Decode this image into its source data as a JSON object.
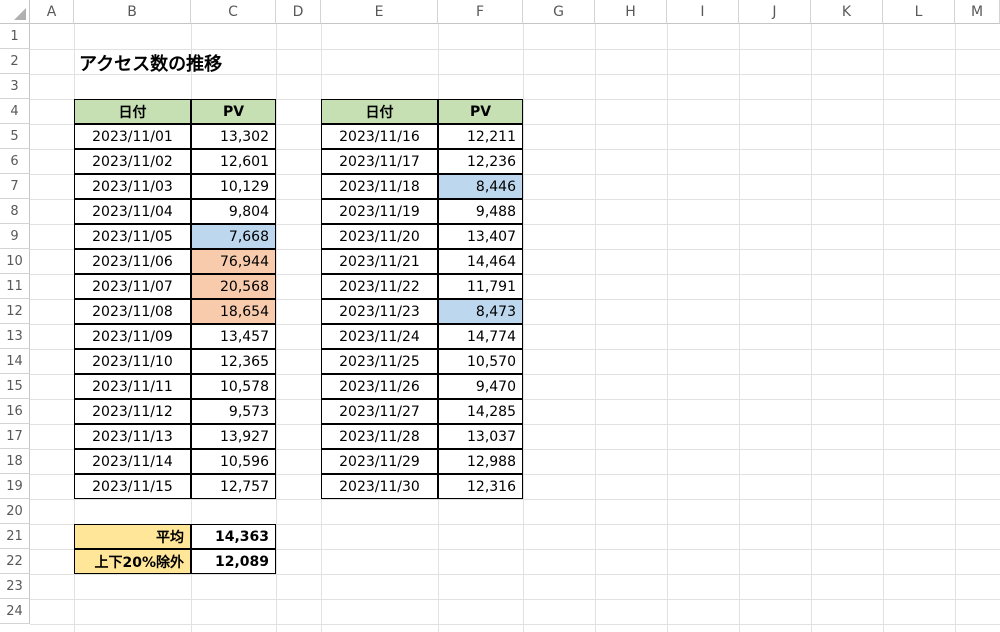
{
  "sheet": {
    "columns": [
      "A",
      "B",
      "C",
      "D",
      "E",
      "F",
      "G",
      "H",
      "I",
      "J",
      "K",
      "L",
      "M"
    ],
    "rows": [
      "1",
      "2",
      "3",
      "4",
      "5",
      "6",
      "7",
      "8",
      "9",
      "10",
      "11",
      "12",
      "13",
      "14",
      "15",
      "16",
      "17",
      "18",
      "19",
      "20",
      "21",
      "22",
      "23",
      "24"
    ],
    "title": "アクセス数の推移",
    "table1": {
      "header_date": "日付",
      "header_pv": "PV",
      "rows": [
        {
          "date": "2023/11/01",
          "pv": "13,302",
          "hl": ""
        },
        {
          "date": "2023/11/02",
          "pv": "12,601",
          "hl": ""
        },
        {
          "date": "2023/11/03",
          "pv": "10,129",
          "hl": ""
        },
        {
          "date": "2023/11/04",
          "pv": "9,804",
          "hl": ""
        },
        {
          "date": "2023/11/05",
          "pv": "7,668",
          "hl": "blue"
        },
        {
          "date": "2023/11/06",
          "pv": "76,944",
          "hl": "orange"
        },
        {
          "date": "2023/11/07",
          "pv": "20,568",
          "hl": "orange"
        },
        {
          "date": "2023/11/08",
          "pv": "18,654",
          "hl": "orange"
        },
        {
          "date": "2023/11/09",
          "pv": "13,457",
          "hl": ""
        },
        {
          "date": "2023/11/10",
          "pv": "12,365",
          "hl": ""
        },
        {
          "date": "2023/11/11",
          "pv": "10,578",
          "hl": ""
        },
        {
          "date": "2023/11/12",
          "pv": "9,573",
          "hl": ""
        },
        {
          "date": "2023/11/13",
          "pv": "13,927",
          "hl": ""
        },
        {
          "date": "2023/11/14",
          "pv": "10,596",
          "hl": ""
        },
        {
          "date": "2023/11/15",
          "pv": "12,757",
          "hl": ""
        }
      ]
    },
    "table2": {
      "header_date": "日付",
      "header_pv": "PV",
      "rows": [
        {
          "date": "2023/11/16",
          "pv": "12,211",
          "hl": ""
        },
        {
          "date": "2023/11/17",
          "pv": "12,236",
          "hl": ""
        },
        {
          "date": "2023/11/18",
          "pv": "8,446",
          "hl": "blue"
        },
        {
          "date": "2023/11/19",
          "pv": "9,488",
          "hl": ""
        },
        {
          "date": "2023/11/20",
          "pv": "13,407",
          "hl": ""
        },
        {
          "date": "2023/11/21",
          "pv": "14,464",
          "hl": ""
        },
        {
          "date": "2023/11/22",
          "pv": "11,791",
          "hl": ""
        },
        {
          "date": "2023/11/23",
          "pv": "8,473",
          "hl": "blue"
        },
        {
          "date": "2023/11/24",
          "pv": "14,774",
          "hl": ""
        },
        {
          "date": "2023/11/25",
          "pv": "10,570",
          "hl": ""
        },
        {
          "date": "2023/11/26",
          "pv": "9,470",
          "hl": ""
        },
        {
          "date": "2023/11/27",
          "pv": "14,285",
          "hl": ""
        },
        {
          "date": "2023/11/28",
          "pv": "13,037",
          "hl": ""
        },
        {
          "date": "2023/11/29",
          "pv": "12,988",
          "hl": ""
        },
        {
          "date": "2023/11/30",
          "pv": "12,316",
          "hl": ""
        }
      ]
    },
    "summary": {
      "average_label": "平均",
      "average_value": "14,363",
      "trimmed_label": "上下20%除外",
      "trimmed_value": "12,089"
    },
    "colors": {
      "header_green": "#c6e0b4",
      "highlight_blue": "#bdd7ee",
      "highlight_orange": "#f8cbad",
      "summary_yellow": "#ffe699"
    }
  }
}
